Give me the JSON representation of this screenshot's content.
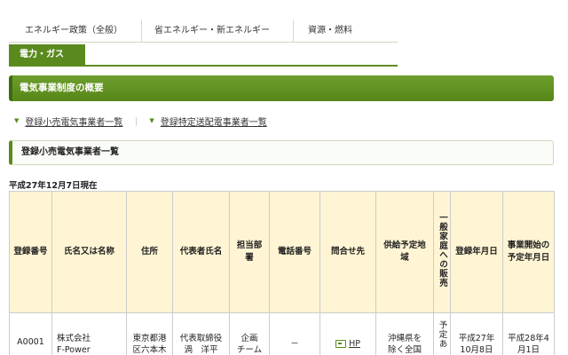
{
  "breadcrumb": [
    "",
    "",
    "",
    "",
    "",
    ""
  ],
  "tabs": {
    "energy_policy": "エネルギー政策（全般）",
    "conservation": "省エネルギー・新エネルギー",
    "resources": "資源・燃料",
    "electricity_gas": "電力・ガス"
  },
  "section_title": "電気事業制度の概要",
  "links": {
    "retail": "登録小売電気事業者一覧",
    "transmission": "登録特定送配電事業者一覧",
    "separator": "｜"
  },
  "sub_title": "登録小売電気事業者一覧",
  "as_of": "平成27年12月7日現在",
  "table": {
    "headers": {
      "reg_no": "登録番号",
      "name": "氏名又は名称",
      "address": "住所",
      "rep": "代表者氏名",
      "dept": "担当部署",
      "phone": "電話番号",
      "contact": "問合せ先",
      "area": "供給予定地域",
      "household": "一般家庭への販売",
      "reg_date": "登録年月日",
      "start_date": "事業開始の予定年月日"
    },
    "rows": [
      {
        "reg_no": "A0001",
        "name": "株式会社\nF-Power",
        "address": "東京都港\n区六本木",
        "rep": "代表取締役\n渦　洋平",
        "dept": "企画\nチーム",
        "phone": "－",
        "contact": "HP",
        "area": "沖縄県を\n除く全国",
        "household": "予定あ",
        "reg_date": "平成27年\n10月8日",
        "start_date": "平成28年4\n月1日"
      }
    ]
  }
}
